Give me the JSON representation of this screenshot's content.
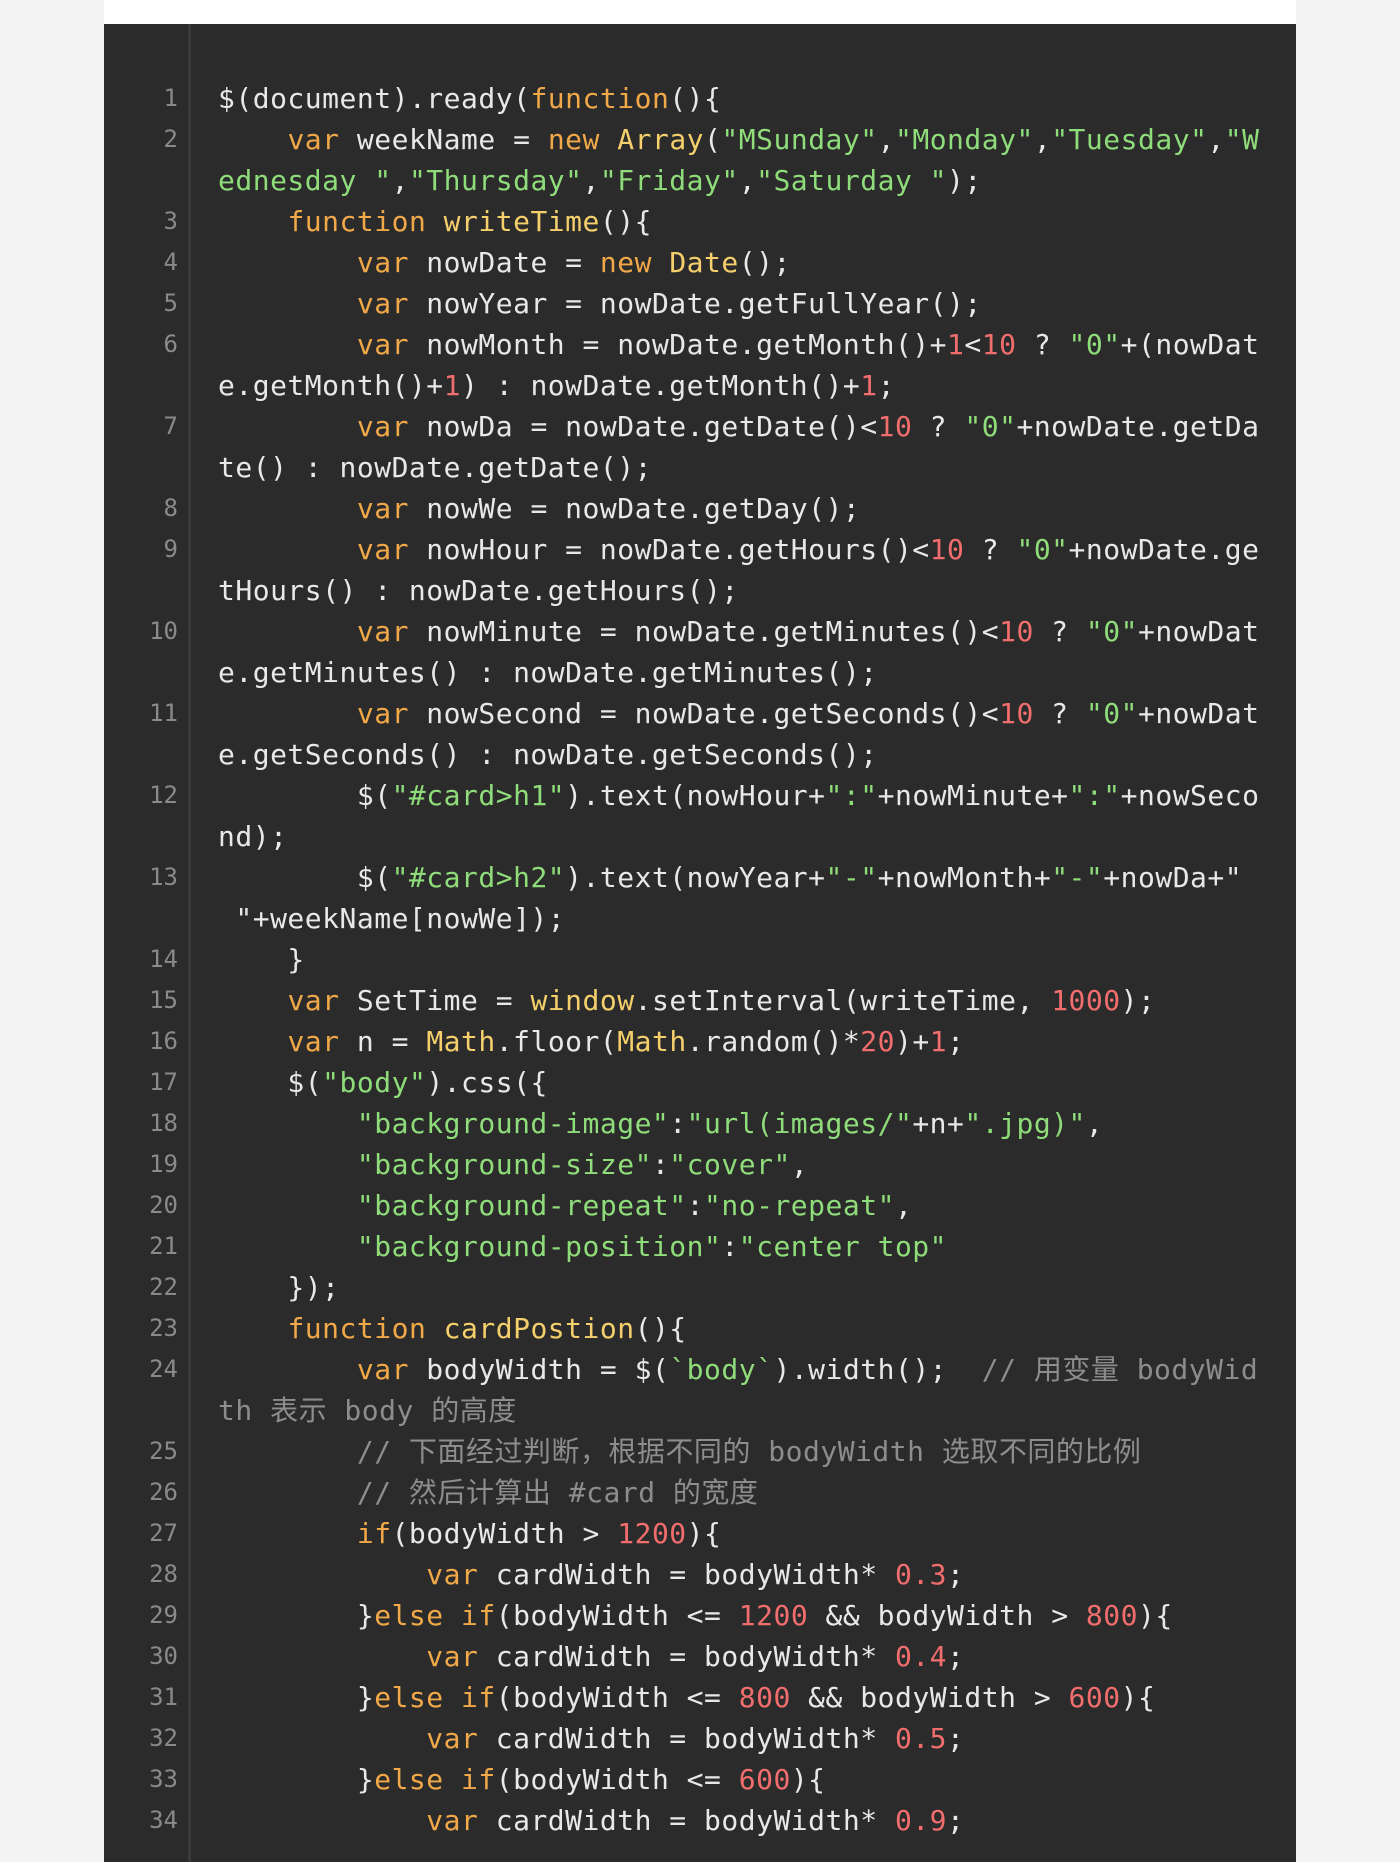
{
  "colors": {
    "background": "#2b2b2b",
    "line_number": "#8a8a8a",
    "default_text": "#e8e8e8",
    "keyword": "#f0a848",
    "function_name": "#f4cf6b",
    "string": "#8fdc7a",
    "number": "#f26d6d",
    "comment": "#8d8d8d"
  },
  "code": {
    "lines": [
      {
        "number": "1",
        "rows": [
          [
            [
              "d",
              "$(document).ready("
            ],
            [
              "k",
              "function"
            ],
            [
              "d",
              "(){"
            ]
          ]
        ]
      },
      {
        "number": "2",
        "rows": [
          [
            [
              "d",
              "    "
            ],
            [
              "k",
              "var"
            ],
            [
              "d",
              " weekName = "
            ],
            [
              "k",
              "new"
            ],
            [
              "d",
              " "
            ],
            [
              "f",
              "Array"
            ],
            [
              "d",
              "("
            ],
            [
              "s",
              "\"MSunday\""
            ],
            [
              "d",
              ","
            ],
            [
              "s",
              "\"Monday\""
            ],
            [
              "d",
              ","
            ],
            [
              "s",
              "\"Tuesday\""
            ],
            [
              "d",
              ","
            ],
            [
              "s",
              "\"W"
            ]
          ],
          [
            [
              "s",
              "ednesday \""
            ],
            [
              "d",
              ","
            ],
            [
              "s",
              "\"Thursday\""
            ],
            [
              "d",
              ","
            ],
            [
              "s",
              "\"Friday\""
            ],
            [
              "d",
              ","
            ],
            [
              "s",
              "\"Saturday \""
            ],
            [
              "d",
              ");"
            ]
          ]
        ]
      },
      {
        "number": "3",
        "rows": [
          [
            [
              "d",
              "    "
            ],
            [
              "k",
              "function"
            ],
            [
              "d",
              " "
            ],
            [
              "f",
              "writeTime"
            ],
            [
              "d",
              "(){"
            ]
          ]
        ]
      },
      {
        "number": "4",
        "rows": [
          [
            [
              "d",
              "        "
            ],
            [
              "k",
              "var"
            ],
            [
              "d",
              " nowDate = "
            ],
            [
              "k",
              "new"
            ],
            [
              "d",
              " "
            ],
            [
              "f",
              "Date"
            ],
            [
              "d",
              "();"
            ]
          ]
        ]
      },
      {
        "number": "5",
        "rows": [
          [
            [
              "d",
              "        "
            ],
            [
              "k",
              "var"
            ],
            [
              "d",
              " nowYear = nowDate.getFullYear();"
            ]
          ]
        ]
      },
      {
        "number": "6",
        "rows": [
          [
            [
              "d",
              "        "
            ],
            [
              "k",
              "var"
            ],
            [
              "d",
              " nowMonth = nowDate.getMonth()+"
            ],
            [
              "n",
              "1"
            ],
            [
              "d",
              "<"
            ],
            [
              "n",
              "10"
            ],
            [
              "d",
              " ? "
            ],
            [
              "s",
              "\"0\""
            ],
            [
              "d",
              "+(nowDat"
            ]
          ],
          [
            [
              "d",
              "e.getMonth()+"
            ],
            [
              "n",
              "1"
            ],
            [
              "d",
              ") : nowDate.getMonth()+"
            ],
            [
              "n",
              "1"
            ],
            [
              "d",
              ";"
            ]
          ]
        ]
      },
      {
        "number": "7",
        "rows": [
          [
            [
              "d",
              "        "
            ],
            [
              "k",
              "var"
            ],
            [
              "d",
              " nowDa = nowDate.getDate()<"
            ],
            [
              "n",
              "10"
            ],
            [
              "d",
              " ? "
            ],
            [
              "s",
              "\"0\""
            ],
            [
              "d",
              "+nowDate.getDa"
            ]
          ],
          [
            [
              "d",
              "te() : nowDate.getDate();"
            ]
          ]
        ]
      },
      {
        "number": "8",
        "rows": [
          [
            [
              "d",
              "        "
            ],
            [
              "k",
              "var"
            ],
            [
              "d",
              " nowWe = nowDate.getDay();"
            ]
          ]
        ]
      },
      {
        "number": "9",
        "rows": [
          [
            [
              "d",
              "        "
            ],
            [
              "k",
              "var"
            ],
            [
              "d",
              " nowHour = nowDate.getHours()<"
            ],
            [
              "n",
              "10"
            ],
            [
              "d",
              " ? "
            ],
            [
              "s",
              "\"0\""
            ],
            [
              "d",
              "+nowDate.ge"
            ]
          ],
          [
            [
              "d",
              "tHours() : nowDate.getHours();"
            ]
          ]
        ]
      },
      {
        "number": "10",
        "rows": [
          [
            [
              "d",
              "        "
            ],
            [
              "k",
              "var"
            ],
            [
              "d",
              " nowMinute = nowDate.getMinutes()<"
            ],
            [
              "n",
              "10"
            ],
            [
              "d",
              " ? "
            ],
            [
              "s",
              "\"0\""
            ],
            [
              "d",
              "+nowDat"
            ]
          ],
          [
            [
              "d",
              "e.getMinutes() : nowDate.getMinutes();"
            ]
          ]
        ]
      },
      {
        "number": "11",
        "rows": [
          [
            [
              "d",
              "        "
            ],
            [
              "k",
              "var"
            ],
            [
              "d",
              " nowSecond = nowDate.getSeconds()<"
            ],
            [
              "n",
              "10"
            ],
            [
              "d",
              " ? "
            ],
            [
              "s",
              "\"0\""
            ],
            [
              "d",
              "+nowDat"
            ]
          ],
          [
            [
              "d",
              "e.getSeconds() : nowDate.getSeconds();"
            ]
          ]
        ]
      },
      {
        "number": "12",
        "rows": [
          [
            [
              "d",
              "        $("
            ],
            [
              "s",
              "\"#card>h1\""
            ],
            [
              "d",
              ").text(nowHour+"
            ],
            [
              "s",
              "\":\""
            ],
            [
              "d",
              "+nowMinute+"
            ],
            [
              "s",
              "\":\""
            ],
            [
              "d",
              "+nowSeco"
            ]
          ],
          [
            [
              "d",
              "nd);"
            ]
          ]
        ]
      },
      {
        "number": "13",
        "rows": [
          [
            [
              "d",
              "        $("
            ],
            [
              "s",
              "\"#card>h2\""
            ],
            [
              "d",
              ").text(nowYear+"
            ],
            [
              "s",
              "\"-\""
            ],
            [
              "d",
              "+nowMonth+"
            ],
            [
              "s",
              "\"-\""
            ],
            [
              "d",
              "+nowDa+\""
            ]
          ],
          [
            [
              "d",
              " \"+weekName[nowWe]);"
            ]
          ]
        ]
      },
      {
        "number": "14",
        "rows": [
          [
            [
              "d",
              "    }"
            ]
          ]
        ]
      },
      {
        "number": "15",
        "rows": [
          [
            [
              "d",
              "    "
            ],
            [
              "k",
              "var"
            ],
            [
              "d",
              " SetTime = "
            ],
            [
              "f",
              "window"
            ],
            [
              "d",
              ".setInterval(writeTime, "
            ],
            [
              "n",
              "1000"
            ],
            [
              "d",
              ");"
            ]
          ]
        ]
      },
      {
        "number": "16",
        "rows": [
          [
            [
              "d",
              "    "
            ],
            [
              "k",
              "var"
            ],
            [
              "d",
              " n = "
            ],
            [
              "f",
              "Math"
            ],
            [
              "d",
              ".floor("
            ],
            [
              "f",
              "Math"
            ],
            [
              "d",
              ".random()*"
            ],
            [
              "n",
              "20"
            ],
            [
              "d",
              ")+"
            ],
            [
              "n",
              "1"
            ],
            [
              "d",
              ";"
            ]
          ]
        ]
      },
      {
        "number": "17",
        "rows": [
          [
            [
              "d",
              "    $("
            ],
            [
              "s",
              "\"body\""
            ],
            [
              "d",
              ").css({"
            ]
          ]
        ]
      },
      {
        "number": "18",
        "rows": [
          [
            [
              "d",
              "        "
            ],
            [
              "s",
              "\"background-image\""
            ],
            [
              "d",
              ":"
            ],
            [
              "s",
              "\"url(images/\""
            ],
            [
              "d",
              "+n+"
            ],
            [
              "s",
              "\".jpg)\""
            ],
            [
              "d",
              ","
            ]
          ]
        ]
      },
      {
        "number": "19",
        "rows": [
          [
            [
              "d",
              "        "
            ],
            [
              "s",
              "\"background-size\""
            ],
            [
              "d",
              ":"
            ],
            [
              "s",
              "\"cover\""
            ],
            [
              "d",
              ","
            ]
          ]
        ]
      },
      {
        "number": "20",
        "rows": [
          [
            [
              "d",
              "        "
            ],
            [
              "s",
              "\"background-repeat\""
            ],
            [
              "d",
              ":"
            ],
            [
              "s",
              "\"no-repeat\""
            ],
            [
              "d",
              ","
            ]
          ]
        ]
      },
      {
        "number": "21",
        "rows": [
          [
            [
              "d",
              "        "
            ],
            [
              "s",
              "\"background-position\""
            ],
            [
              "d",
              ":"
            ],
            [
              "s",
              "\"center top\""
            ]
          ]
        ]
      },
      {
        "number": "22",
        "rows": [
          [
            [
              "d",
              "    });"
            ]
          ]
        ]
      },
      {
        "number": "23",
        "rows": [
          [
            [
              "d",
              "    "
            ],
            [
              "k",
              "function"
            ],
            [
              "d",
              " "
            ],
            [
              "f",
              "cardPostion"
            ],
            [
              "d",
              "(){"
            ]
          ]
        ]
      },
      {
        "number": "24",
        "rows": [
          [
            [
              "d",
              "        "
            ],
            [
              "k",
              "var"
            ],
            [
              "d",
              " bodyWidth = $("
            ],
            [
              "s",
              "`body`"
            ],
            [
              "d",
              ").width();  "
            ],
            [
              "c",
              "// 用变量 bodyWid"
            ]
          ],
          [
            [
              "c",
              "th 表示 body 的高度"
            ]
          ]
        ]
      },
      {
        "number": "25",
        "rows": [
          [
            [
              "d",
              "        "
            ],
            [
              "c",
              "// 下面经过判断，根据不同的 bodyWidth 选取不同的比例"
            ]
          ]
        ]
      },
      {
        "number": "26",
        "rows": [
          [
            [
              "d",
              "        "
            ],
            [
              "c",
              "// 然后计算出 #card 的宽度"
            ]
          ]
        ]
      },
      {
        "number": "27",
        "rows": [
          [
            [
              "d",
              "        "
            ],
            [
              "k",
              "if"
            ],
            [
              "d",
              "(bodyWidth > "
            ],
            [
              "n",
              "1200"
            ],
            [
              "d",
              "){"
            ]
          ]
        ]
      },
      {
        "number": "28",
        "rows": [
          [
            [
              "d",
              "            "
            ],
            [
              "k",
              "var"
            ],
            [
              "d",
              " cardWidth = bodyWidth* "
            ],
            [
              "n",
              "0.3"
            ],
            [
              "d",
              ";"
            ]
          ]
        ]
      },
      {
        "number": "29",
        "rows": [
          [
            [
              "d",
              "        }"
            ],
            [
              "k",
              "else if"
            ],
            [
              "d",
              "(bodyWidth <= "
            ],
            [
              "n",
              "1200"
            ],
            [
              "d",
              " && bodyWidth > "
            ],
            [
              "n",
              "800"
            ],
            [
              "d",
              "){"
            ]
          ]
        ]
      },
      {
        "number": "30",
        "rows": [
          [
            [
              "d",
              "            "
            ],
            [
              "k",
              "var"
            ],
            [
              "d",
              " cardWidth = bodyWidth* "
            ],
            [
              "n",
              "0.4"
            ],
            [
              "d",
              ";"
            ]
          ]
        ]
      },
      {
        "number": "31",
        "rows": [
          [
            [
              "d",
              "        }"
            ],
            [
              "k",
              "else if"
            ],
            [
              "d",
              "(bodyWidth <= "
            ],
            [
              "n",
              "800"
            ],
            [
              "d",
              " && bodyWidth > "
            ],
            [
              "n",
              "600"
            ],
            [
              "d",
              "){"
            ]
          ]
        ]
      },
      {
        "number": "32",
        "rows": [
          [
            [
              "d",
              "            "
            ],
            [
              "k",
              "var"
            ],
            [
              "d",
              " cardWidth = bodyWidth* "
            ],
            [
              "n",
              "0.5"
            ],
            [
              "d",
              ";"
            ]
          ]
        ]
      },
      {
        "number": "33",
        "rows": [
          [
            [
              "d",
              "        }"
            ],
            [
              "k",
              "else if"
            ],
            [
              "d",
              "(bodyWidth <= "
            ],
            [
              "n",
              "600"
            ],
            [
              "d",
              "){"
            ]
          ]
        ]
      },
      {
        "number": "34",
        "rows": [
          [
            [
              "d",
              "            "
            ],
            [
              "k",
              "var"
            ],
            [
              "d",
              " cardWidth = bodyWidth* "
            ],
            [
              "n",
              "0.9"
            ],
            [
              "d",
              ";"
            ]
          ]
        ]
      }
    ]
  }
}
